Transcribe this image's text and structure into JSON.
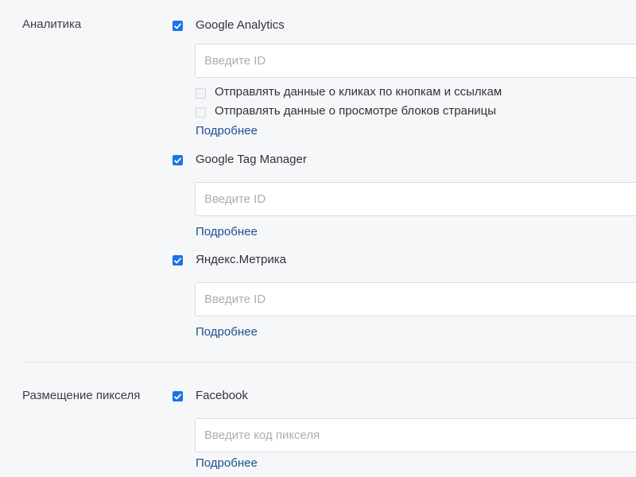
{
  "sections": {
    "analytics": {
      "label": "Аналитика",
      "google_analytics": {
        "label": "Google Analytics",
        "checked": true,
        "input_placeholder": "Введите ID",
        "input_value": "",
        "sub_options": [
          {
            "label": "Отправлять данные о кликах по кнопкам и ссылкам",
            "checked": false
          },
          {
            "label": "Отправлять данные о просмотре блоков страницы",
            "checked": false
          }
        ],
        "more_link": "Подробнее"
      },
      "google_tag_manager": {
        "label": "Google Tag Manager",
        "checked": true,
        "input_placeholder": "Введите ID",
        "input_value": "",
        "more_link": "Подробнее"
      },
      "yandex_metrika": {
        "label": "Яндекс.Метрика",
        "checked": true,
        "input_placeholder": "Введите ID",
        "input_value": "",
        "more_link": "Подробнее"
      }
    },
    "pixel": {
      "label": "Размещение пикселя",
      "facebook": {
        "label": "Facebook",
        "checked": true,
        "input_placeholder": "Введите код пикселя",
        "input_value": "",
        "more_link": "Подробнее"
      }
    }
  },
  "colors": {
    "background": "#f6f7f9",
    "checkbox_accent": "#1a73e8",
    "link": "#1f4f8f",
    "placeholder": "#a9aeb6",
    "border": "#d9dce1"
  }
}
